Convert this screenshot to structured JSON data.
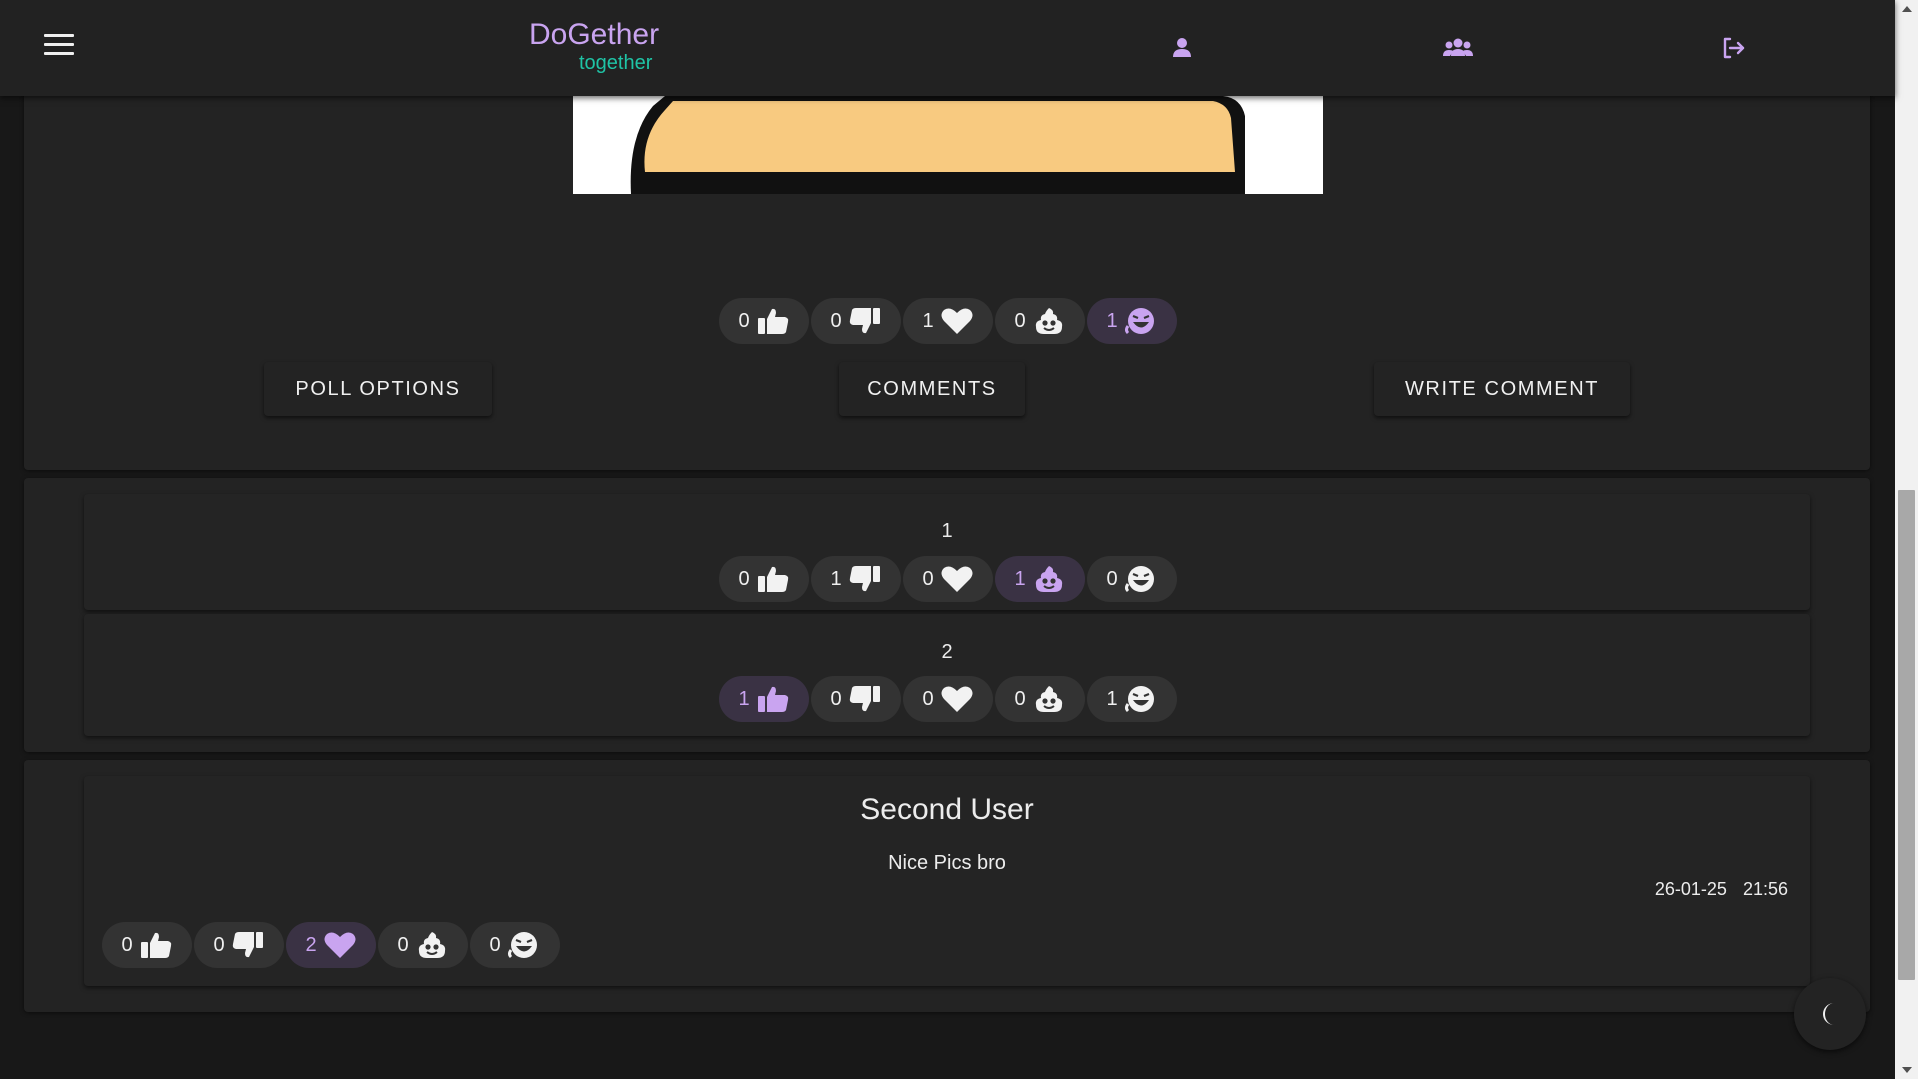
{
  "header": {
    "title": "DoGether",
    "subtitle": "together",
    "icons": [
      "menu-icon",
      "user-icon",
      "users-icon",
      "logout-icon"
    ]
  },
  "colors": {
    "accent": "#c9a4f0",
    "subtitle": "#1fc4a6",
    "background": "#181818",
    "card": "#232323",
    "pill": "#333333",
    "pill_active": "#3a3244"
  },
  "post": {
    "reactions": [
      {
        "icon": "thumbs-up-icon",
        "count": "0",
        "active": false
      },
      {
        "icon": "thumbs-down-icon",
        "count": "0",
        "active": false
      },
      {
        "icon": "heart-icon",
        "count": "1",
        "active": false
      },
      {
        "icon": "poop-icon",
        "count": "0",
        "active": false
      },
      {
        "icon": "laugh-icon",
        "count": "1",
        "active": true
      }
    ],
    "buttons": {
      "poll_options": "POLL OPTIONS",
      "comments": "COMMENTS",
      "write_comment": "WRITE COMMENT"
    }
  },
  "poll_options": [
    {
      "label": "1",
      "reactions": [
        {
          "icon": "thumbs-up-icon",
          "count": "0",
          "active": false
        },
        {
          "icon": "thumbs-down-icon",
          "count": "1",
          "active": false
        },
        {
          "icon": "heart-icon",
          "count": "0",
          "active": false
        },
        {
          "icon": "poop-icon",
          "count": "1",
          "active": true
        },
        {
          "icon": "laugh-icon",
          "count": "0",
          "active": false
        }
      ]
    },
    {
      "label": "2",
      "reactions": [
        {
          "icon": "thumbs-up-icon",
          "count": "1",
          "active": true
        },
        {
          "icon": "thumbs-down-icon",
          "count": "0",
          "active": false
        },
        {
          "icon": "heart-icon",
          "count": "0",
          "active": false
        },
        {
          "icon": "poop-icon",
          "count": "0",
          "active": false
        },
        {
          "icon": "laugh-icon",
          "count": "1",
          "active": false
        }
      ]
    }
  ],
  "comment": {
    "author": "Second User",
    "text": "Nice Pics bro",
    "date": "26-01-25",
    "time": "21:56",
    "reactions": [
      {
        "icon": "thumbs-up-icon",
        "count": "0",
        "active": false
      },
      {
        "icon": "thumbs-down-icon",
        "count": "0",
        "active": false
      },
      {
        "icon": "heart-icon",
        "count": "2",
        "active": true
      },
      {
        "icon": "poop-icon",
        "count": "0",
        "active": false
      },
      {
        "icon": "laugh-icon",
        "count": "0",
        "active": false
      }
    ]
  },
  "theme_toggle": {
    "icon": "moon-icon"
  }
}
